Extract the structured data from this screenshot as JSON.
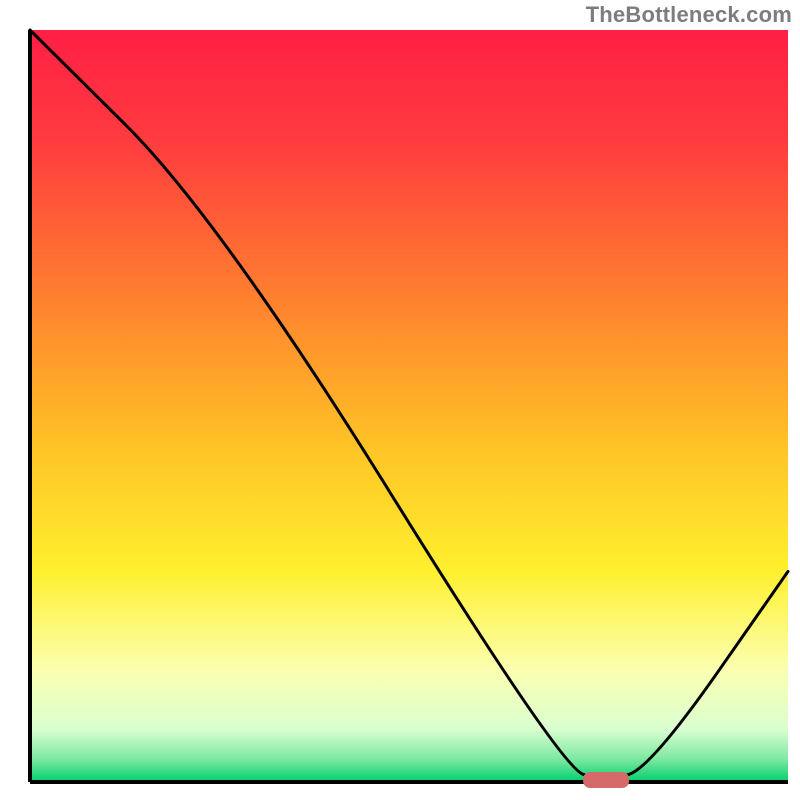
{
  "attribution": "TheBottleneck.com",
  "chart_data": {
    "type": "line",
    "title": "",
    "xlabel": "",
    "ylabel": "",
    "xlim": [
      0,
      100
    ],
    "ylim": [
      0,
      100
    ],
    "x": [
      0,
      25,
      70,
      76,
      82,
      100
    ],
    "values": [
      100,
      75,
      2,
      0,
      2,
      28
    ],
    "minimum_marker": {
      "x": 76,
      "y": 0,
      "color": "#d46a6a"
    },
    "gradient_stops": [
      {
        "offset": 0.0,
        "color": "#ff1f44"
      },
      {
        "offset": 0.15,
        "color": "#ff3c3f"
      },
      {
        "offset": 0.35,
        "color": "#ff7e2f"
      },
      {
        "offset": 0.55,
        "color": "#ffc226"
      },
      {
        "offset": 0.72,
        "color": "#fff02e"
      },
      {
        "offset": 0.85,
        "color": "#fbffb0"
      },
      {
        "offset": 0.93,
        "color": "#d9ffd0"
      },
      {
        "offset": 0.97,
        "color": "#7be8a0"
      },
      {
        "offset": 1.0,
        "color": "#00cf6e"
      }
    ],
    "axes_color": "#000000",
    "curve_color": "#000000",
    "curve_width": 3
  }
}
